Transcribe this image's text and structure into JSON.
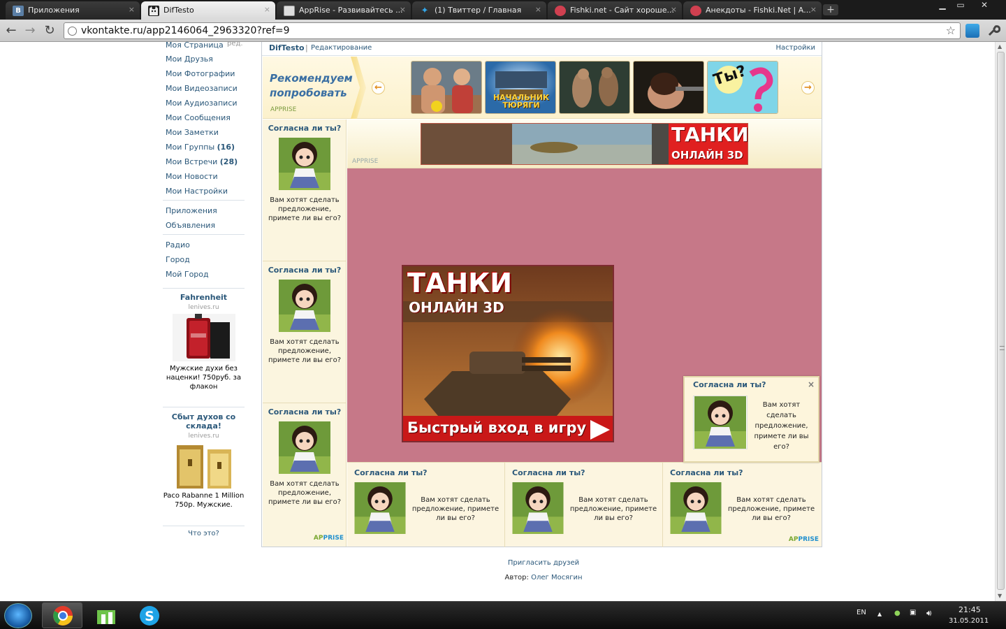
{
  "browser": {
    "tabs": [
      {
        "title": "Приложения",
        "icon": "vk-favicon",
        "fav_letter": "В",
        "fav_color": "#5b7fa6"
      },
      {
        "title": "DifTesto",
        "icon": "cat-favicon",
        "fav_letter": "",
        "fav_color": "#ffffff"
      },
      {
        "title": "AppRise - Развивайтесь ...",
        "icon": "page-favicon",
        "fav_letter": "",
        "fav_color": "#dddddd"
      },
      {
        "title": "(1) Твиттер / Главная",
        "icon": "twitter-favicon",
        "fav_letter": "",
        "fav_color": "#33a6e8"
      },
      {
        "title": "Fishki.net - Сайт хороше...",
        "icon": "fishki-favicon",
        "fav_letter": "",
        "fav_color": "#d04050"
      },
      {
        "title": "Анекдоты - Fishki.Net | А...",
        "icon": "fishki-favicon",
        "fav_letter": "",
        "fav_color": "#d04050"
      }
    ],
    "active_tab": 1,
    "close_glyph": "×",
    "url": "vkontakte.ru/app2146064_2963320?ref=9"
  },
  "left_nav": {
    "edit_label": "ред.",
    "items": [
      {
        "label": "Моя Страница",
        "count": ""
      },
      {
        "label": "Мои Друзья",
        "count": ""
      },
      {
        "label": "Мои Фотографии",
        "count": ""
      },
      {
        "label": "Мои Видеозаписи",
        "count": ""
      },
      {
        "label": "Мои Аудиозаписи",
        "count": ""
      },
      {
        "label": "Мои Сообщения",
        "count": ""
      },
      {
        "label": "Мои Заметки",
        "count": ""
      },
      {
        "label": "Мои Группы",
        "count": "(16)"
      },
      {
        "label": "Мои Встречи",
        "count": "(28)"
      },
      {
        "label": "Мои Новости",
        "count": ""
      },
      {
        "label": "Мои Настройки",
        "count": ""
      }
    ],
    "items2": [
      "Приложения",
      "Объявления"
    ],
    "items3": [
      "Радио",
      "Город",
      "Мой Город"
    ],
    "ads": [
      {
        "title": "Fahrenheit",
        "domain": "lenives.ru",
        "text": "Мужские духи без наценки! 750руб. за флакон"
      },
      {
        "title": "Сбыт духов со склада!",
        "domain": "lenives.ru",
        "text": "Paco Rabanne 1 Million 750р. Мужские."
      }
    ],
    "what_is_this": "Что это?"
  },
  "app": {
    "name": "DifTesto",
    "separator": "|",
    "edit_label": "Редактирование",
    "settings_label": "Настройки",
    "recommend_title": "Рекомендуем попробовать",
    "recommend_brand": "APPRISE",
    "prev_arrow": "←",
    "next_arrow": "→",
    "thumbs": [
      {
        "name": "thumb-fighters",
        "caption": ""
      },
      {
        "name": "thumb-nachalnik-turyagi",
        "caption": "НАЧАЛЬНИК ТЮРЯГИ"
      },
      {
        "name": "thumb-fight-club",
        "caption": ""
      },
      {
        "name": "thumb-woman-dark",
        "caption": ""
      },
      {
        "name": "thumb-ty",
        "caption": "Ты?"
      }
    ],
    "banner_brand": "APPRISE",
    "banner_title": "ТАНКИ",
    "banner_subtitle": "ОНЛАЙН 3D",
    "big_ad": {
      "title": "ТАНКИ",
      "subtitle": "ОНЛАЙН 3D",
      "cta": "Быстрый вход в игру"
    },
    "card_question": "Согласна ли ты?",
    "card_text": "Вам хотят сделать предложение, примете ли вы его?",
    "brand_ap": "AP",
    "brand_prise": "PRISE",
    "popup": {
      "question": "Согласна ли ты?",
      "text": "Вам хотят сделать предложение, примете ли вы его?",
      "close": "×"
    }
  },
  "footer": {
    "invite": "Пригласить друзей",
    "author_label": "Автор:",
    "author_name": "Олег Мосягин"
  },
  "taskbar": {
    "lang": "EN",
    "time": "21:45",
    "date": "31.05.2011"
  }
}
